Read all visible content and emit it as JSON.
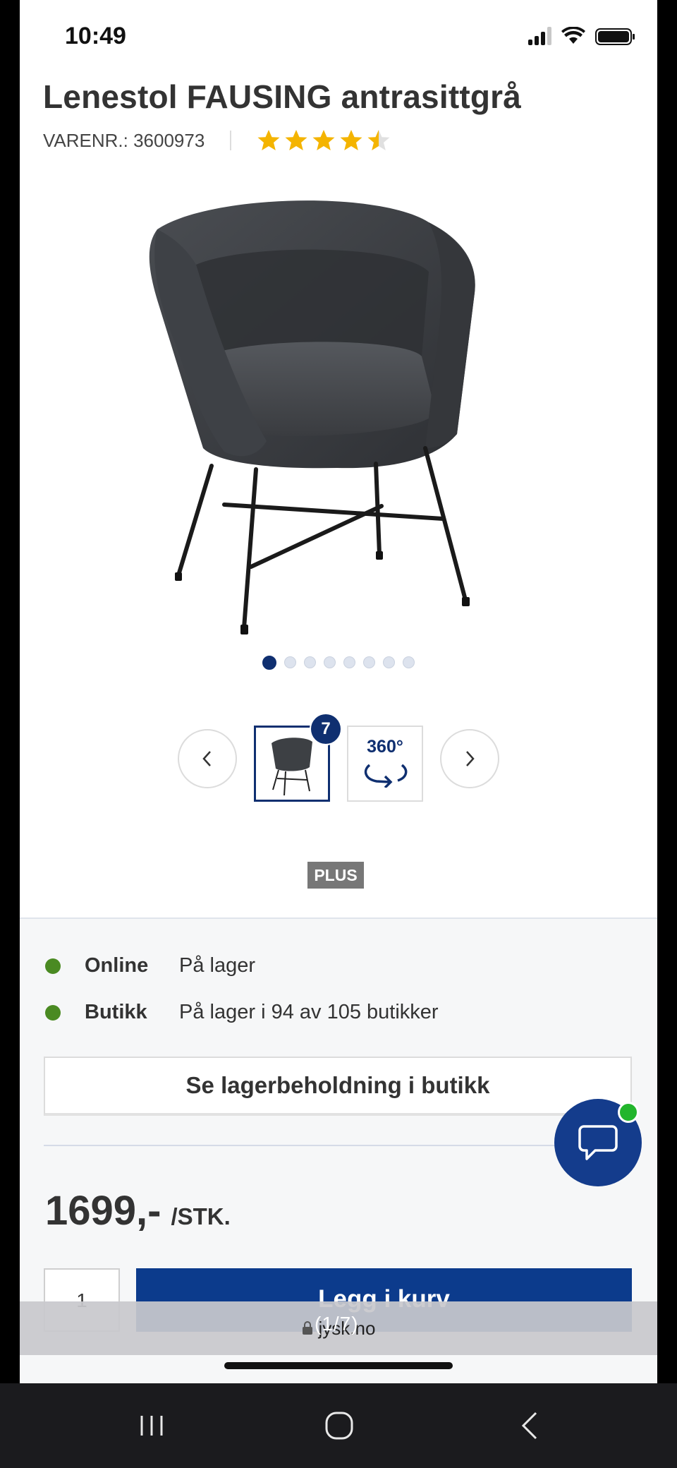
{
  "status_bar": {
    "time": "10:49"
  },
  "product": {
    "title": "Lenestol FAUSING antrasittgrå",
    "item_number_label": "VARENR.: 3600973",
    "rating_stars": 4.5
  },
  "gallery": {
    "image_count": 8,
    "active_index": 0,
    "thumbnail_count_badge": "7",
    "view_360_label": "360°"
  },
  "tag": "PLUS",
  "stock": {
    "online": {
      "label": "Online",
      "value": "På lager"
    },
    "store": {
      "label": "Butikk",
      "value": "På lager i 94 av 105 butikker"
    },
    "check_button": "Se lagerbeholdning i butikk"
  },
  "price": {
    "amount": "1699,-",
    "unit": "/STK."
  },
  "cart": {
    "quantity": "1",
    "add_button": "Legg i kurv"
  },
  "browser": {
    "url": "jysk.no",
    "image_counter": "(1/7)"
  },
  "colors": {
    "brand_blue": "#0f2f70",
    "button_blue": "#0c3b8c",
    "star": "#f4b400",
    "in_stock_green": "#4a8a22"
  }
}
